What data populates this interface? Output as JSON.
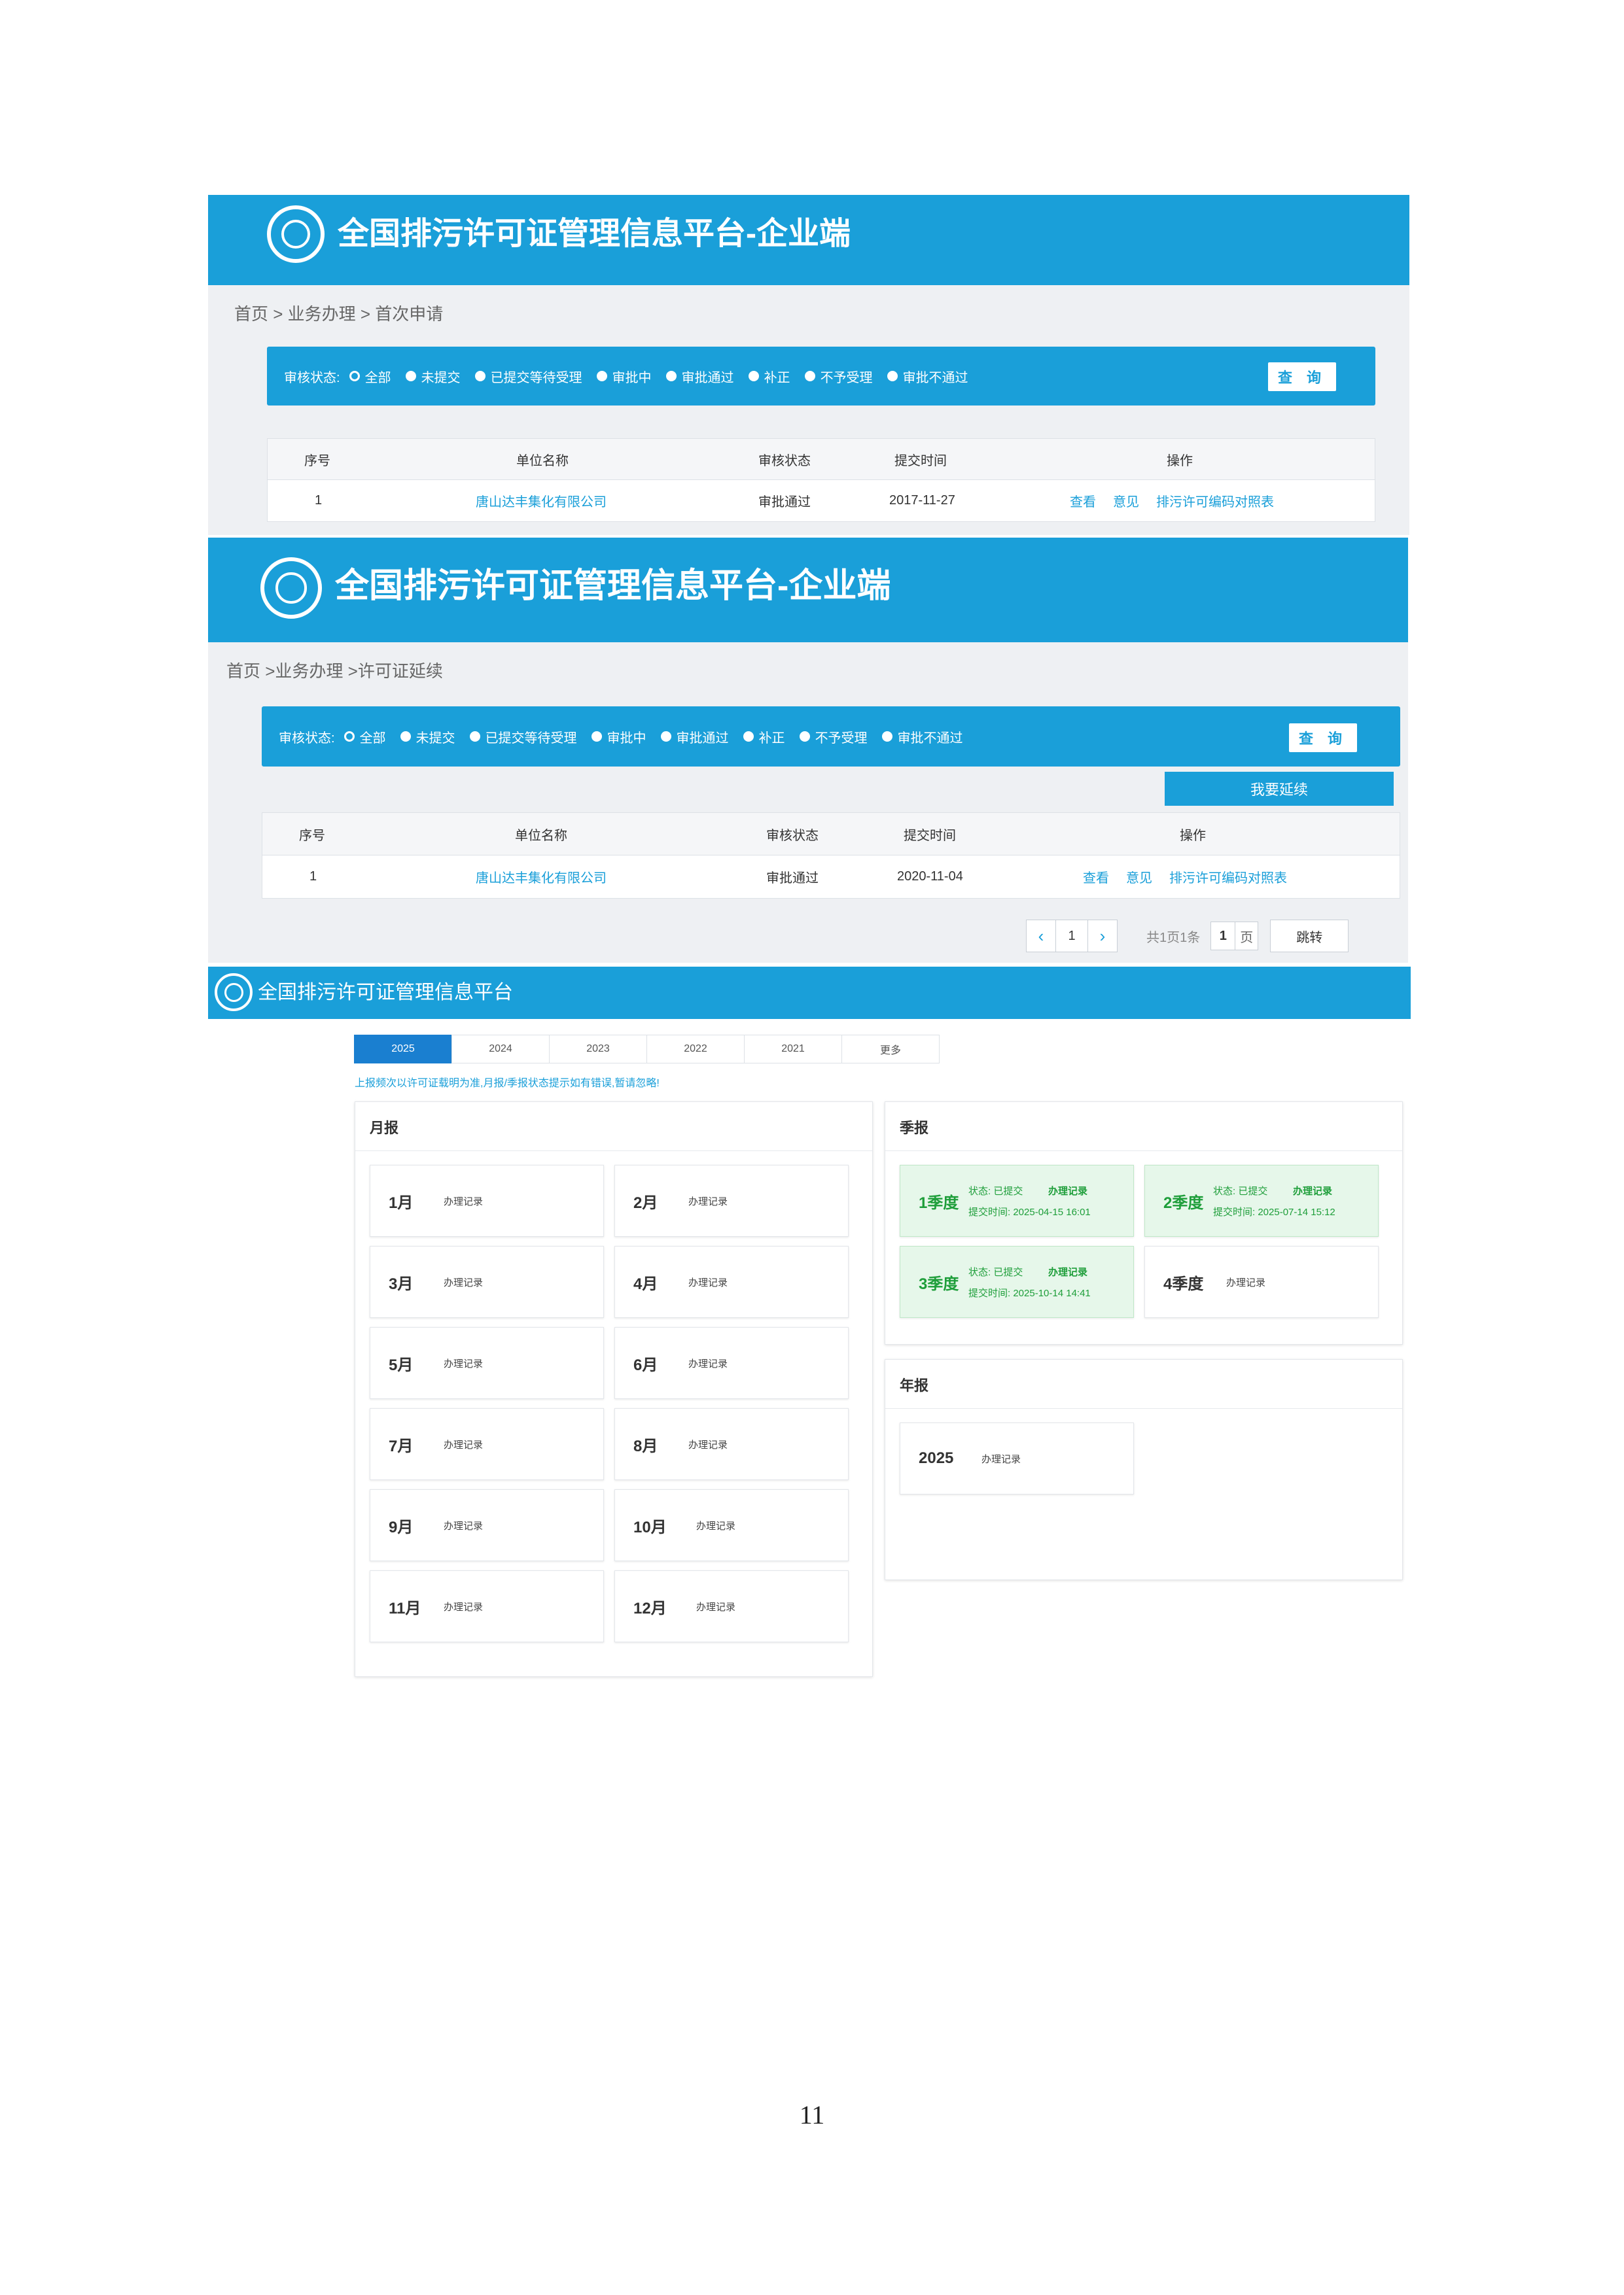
{
  "screen1": {
    "title": "全国排污许可证管理信息平台-企业端",
    "breadcrumb": "首页 > 业务办理 > 首次申请",
    "filter": {
      "label": "审核状态:",
      "options": [
        "全部",
        "未提交",
        "已提交等待受理",
        "审批中",
        "审批通过",
        "补正",
        "不予受理",
        "审批不通过"
      ],
      "query_button": "查 询"
    },
    "table": {
      "headers": [
        "序号",
        "单位名称",
        "审核状态",
        "提交时间",
        "操作"
      ],
      "row": {
        "no": "1",
        "company": "唐山达丰集化有限公司",
        "status": "审批通过",
        "date": "2017-11-27",
        "actions": [
          "查看",
          "意见",
          "排污许可编码对照表"
        ]
      }
    }
  },
  "screen2": {
    "title": "全国排污许可证管理信息平台-企业端",
    "breadcrumb": "首页 >业务办理 >许可证延续",
    "filter": {
      "label": "审核状态:",
      "options": [
        "全部",
        "未提交",
        "已提交等待受理",
        "审批中",
        "审批通过",
        "补正",
        "不予受理",
        "审批不通过"
      ],
      "query_button": "查 询"
    },
    "renew_button": "我要延续",
    "table": {
      "headers": [
        "序号",
        "单位名称",
        "审核状态",
        "提交时间",
        "操作"
      ],
      "row": {
        "no": "1",
        "company": "唐山达丰集化有限公司",
        "status": "审批通过",
        "date": "2020-11-04",
        "actions": [
          "查看",
          "意见",
          "排污许可编码对照表"
        ]
      }
    },
    "pager": {
      "prev": "‹",
      "page": "1",
      "next": "›",
      "summary": "共1页1条",
      "goto_value": "1",
      "goto_unit": "页",
      "goto_button": "跳转"
    }
  },
  "screen3": {
    "title": "全国排污许可证管理信息平台",
    "year_tabs": [
      "2025",
      "2024",
      "2023",
      "2022",
      "2021",
      "更多"
    ],
    "notice": "上报频次以许可证载明为准,月报/季报状态提示如有错误,暂请忽略!",
    "monthly": {
      "title": "月报",
      "record_label": "办理记录",
      "months": [
        "1月",
        "2月",
        "3月",
        "4月",
        "5月",
        "6月",
        "7月",
        "8月",
        "9月",
        "10月",
        "11月",
        "12月"
      ]
    },
    "quarterly": {
      "title": "季报",
      "quarters": [
        {
          "name": "1季度",
          "status": "状态: 已提交",
          "record": "办理记录",
          "time": "提交时间: 2025-04-15 16:01"
        },
        {
          "name": "2季度",
          "status": "状态: 已提交",
          "record": "办理记录",
          "time": "提交时间: 2025-07-14 15:12"
        },
        {
          "name": "3季度",
          "status": "状态: 已提交",
          "record": "办理记录",
          "time": "提交时间: 2025-10-14 14:41"
        },
        {
          "name": "4季度",
          "status": "",
          "record": "办理记录",
          "time": ""
        }
      ]
    },
    "annual": {
      "title": "年报",
      "year": "2025",
      "record": "办理记录"
    }
  },
  "page_number": "11",
  "colors": {
    "brand_blue": "#1a9fd9",
    "success_green": "#1e9e3a",
    "panel_bg": "#eef0f3"
  }
}
